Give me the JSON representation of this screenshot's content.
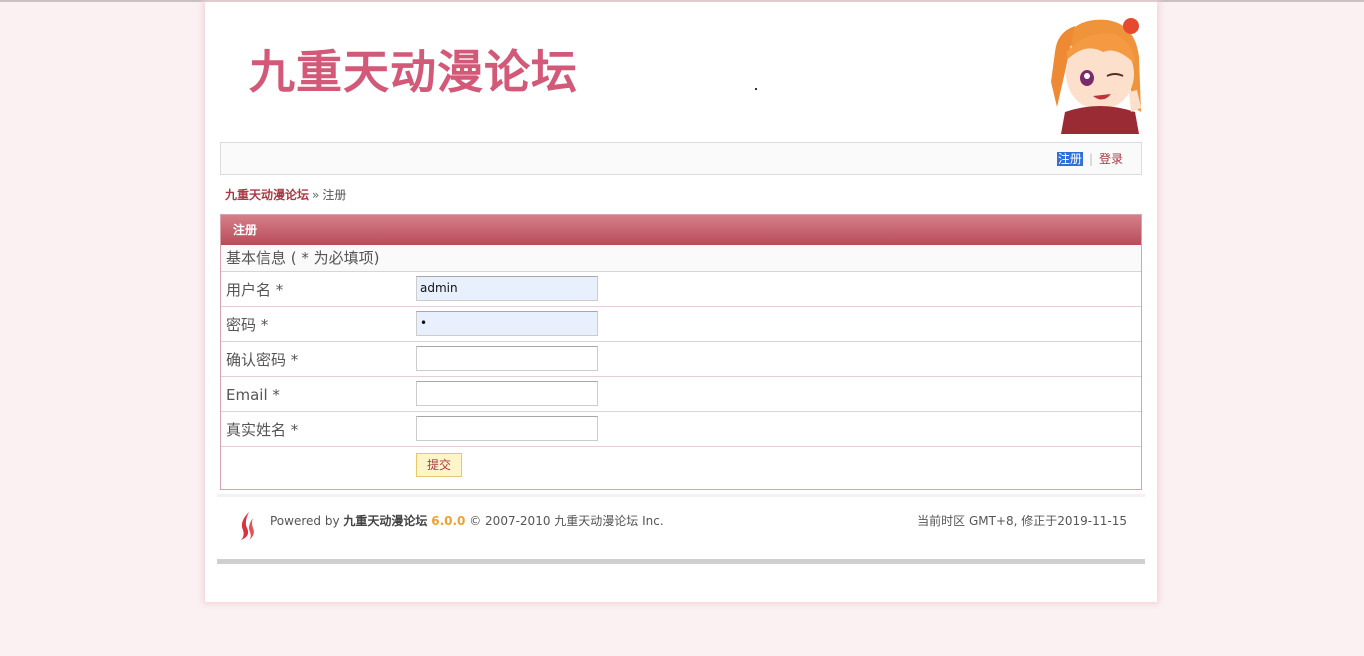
{
  "header": {
    "logo_text": "九重天动漫论坛"
  },
  "nav": {
    "register": "注册",
    "login": "登录"
  },
  "breadcrumb": {
    "home": "九重天动漫论坛",
    "separator": "»",
    "current": "注册"
  },
  "form": {
    "title": "注册",
    "section": "基本信息 ( * 为必填项)",
    "fields": [
      {
        "label": "用户名 *",
        "value": "admin"
      },
      {
        "label": "密码 *",
        "value": "•"
      },
      {
        "label": "确认密码 *",
        "value": ""
      },
      {
        "label": "Email *",
        "value": ""
      },
      {
        "label": "真实姓名 *",
        "value": ""
      }
    ],
    "submit": "提交"
  },
  "footer": {
    "powered_prefix": "Powered by",
    "product": "九重天动漫论坛",
    "version": "6.0.0",
    "copyright": "© 2007-2010 九重天动漫论坛 Inc.",
    "timezone": "当前时区 GMT+8, 修正于2019-11-15"
  },
  "colors": {
    "brand": "#d25a78",
    "header_bar": "#b84c59",
    "link": "#a83a44",
    "version": "#f0a030"
  },
  "icons": {
    "mascot": "anime-mascot-icon",
    "footer": "flame-logo-icon"
  }
}
